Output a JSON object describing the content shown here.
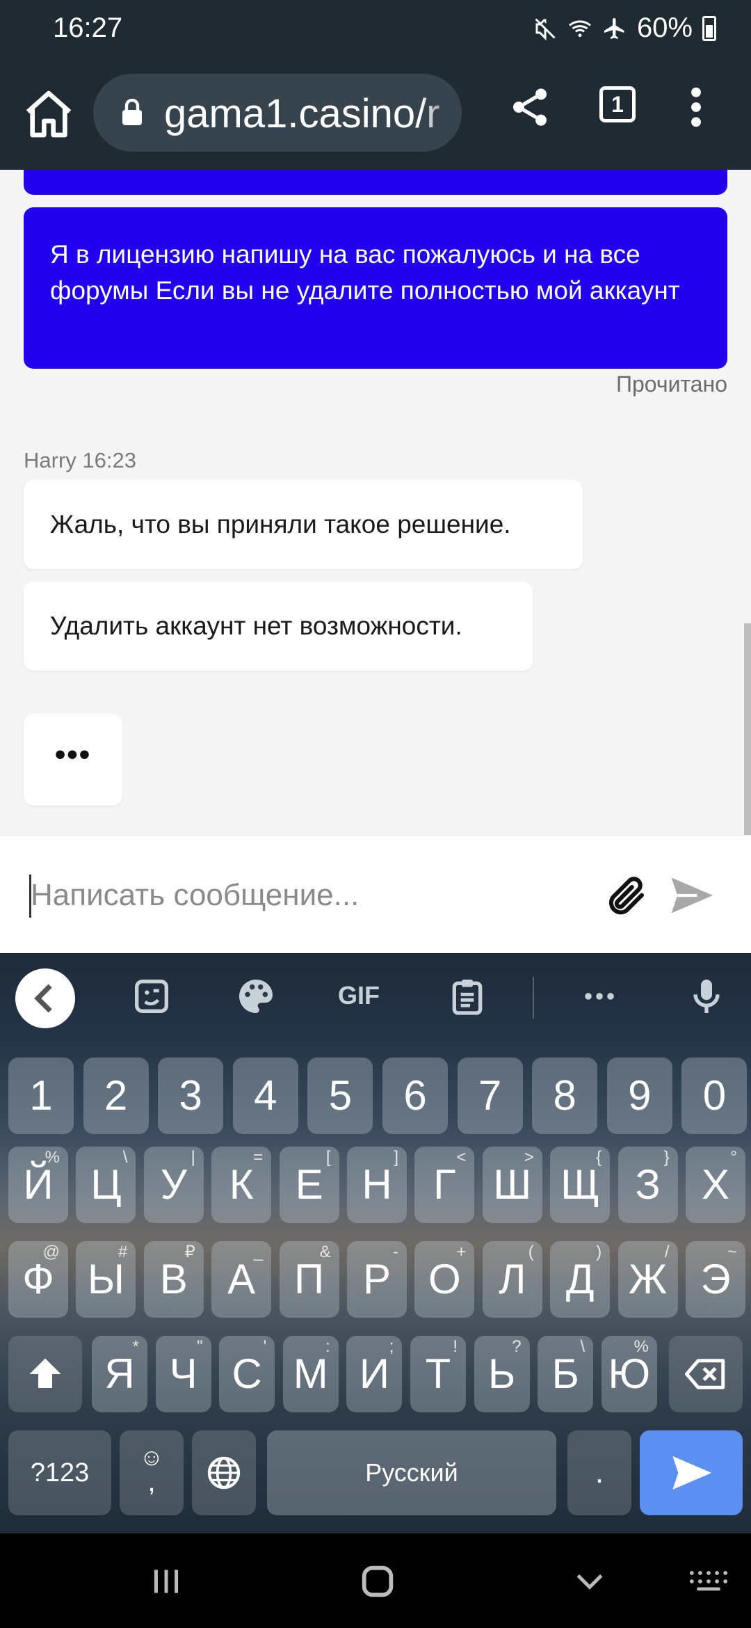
{
  "status_bar": {
    "time": "16:27",
    "battery": "60%"
  },
  "browser": {
    "url": "gama1.casino/r",
    "tab_count": "1"
  },
  "chat": {
    "outgoing_message": "Я в лицензию напишу на вас пожалуюсь и на все форумы Если вы не удалите полностью мой аккаунт",
    "read_status": "Прочитано",
    "sender_line": "Harry 16:23",
    "incoming_messages": [
      "Жаль, что вы приняли такое решение.",
      "Удалить аккаунт нет возможности."
    ],
    "typing_indicator": "•••"
  },
  "compose": {
    "placeholder": "Написать сообщение..."
  },
  "keyboard": {
    "toolbar": {
      "gif": "GIF"
    },
    "rows": {
      "numbers": [
        "1",
        "2",
        "3",
        "4",
        "5",
        "6",
        "7",
        "8",
        "9",
        "0"
      ],
      "row1": [
        "Й",
        "Ц",
        "У",
        "К",
        "Е",
        "Н",
        "Г",
        "Ш",
        "Щ",
        "З",
        "Х"
      ],
      "row1_alt": [
        "%",
        "\\",
        "|",
        "=",
        "[",
        "]",
        "<",
        ">",
        "{",
        "}",
        "°"
      ],
      "row2": [
        "Ф",
        "Ы",
        "В",
        "А",
        "П",
        "Р",
        "О",
        "Л",
        "Д",
        "Ж",
        "Э"
      ],
      "row2_alt": [
        "@",
        "#",
        "₽",
        "_",
        "&",
        "-",
        "+",
        "(",
        ")",
        "/",
        "~"
      ],
      "row3": [
        "Я",
        "Ч",
        "С",
        "М",
        "И",
        "Т",
        "Ь",
        "Б",
        "Ю"
      ],
      "row3_alt": [
        "*",
        "\"",
        "'",
        ":",
        ";",
        "!",
        "?",
        "\\",
        "%"
      ]
    },
    "symbols_key": "?123",
    "emoji_comma_top": "☺",
    "emoji_comma_bottom": ",",
    "space_label": "Русский",
    "period": "."
  }
}
